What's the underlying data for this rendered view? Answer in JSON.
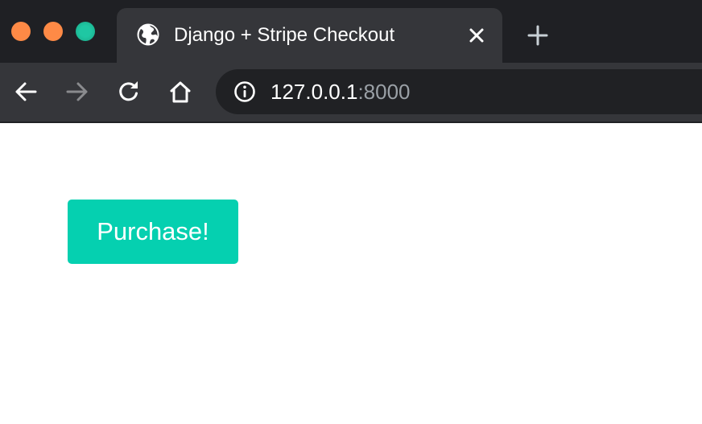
{
  "window": {
    "traffic_lights": [
      "close",
      "minimize",
      "maximize"
    ],
    "colors": {
      "frame": "#1f2024",
      "tab_active": "#35363a",
      "omnibox": "#202124"
    }
  },
  "tab": {
    "title": "Django + Stripe Checkout",
    "favicon": "globe-icon",
    "close_icon": "close-icon"
  },
  "new_tab_icon": "plus-icon",
  "toolbar": {
    "icons": [
      "back-arrow-icon",
      "forward-arrow-icon",
      "reload-icon",
      "home-icon"
    ]
  },
  "address_bar": {
    "site_info_icon": "info-icon",
    "host": "127.0.0.1",
    "port": ":8000"
  },
  "page": {
    "purchase_button_label": "Purchase!",
    "purchase_button_color": "#05d0b0"
  }
}
